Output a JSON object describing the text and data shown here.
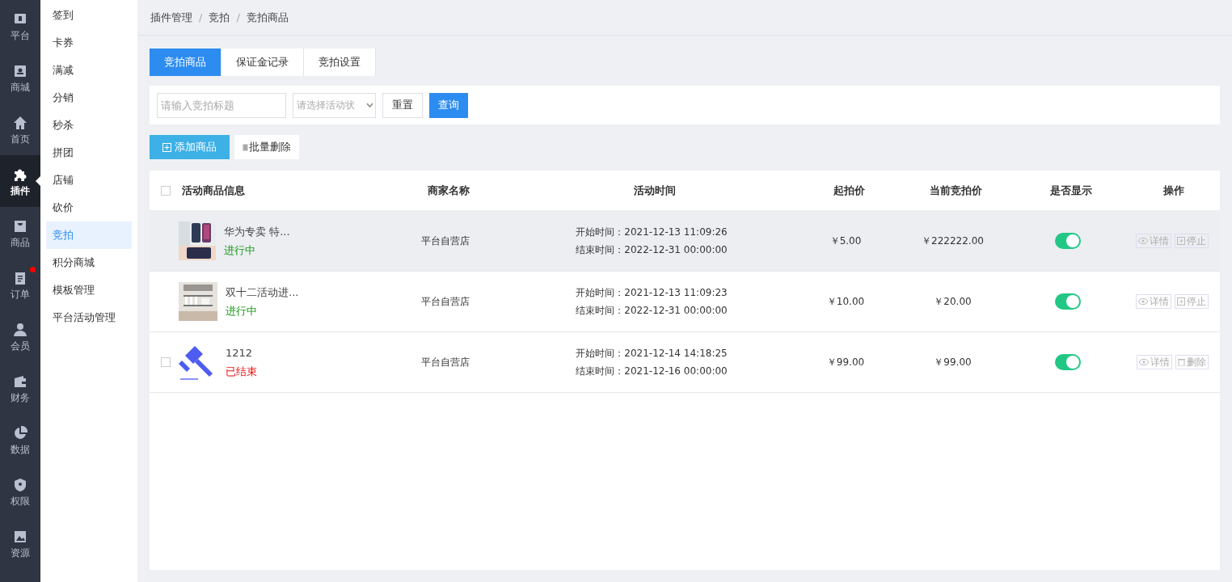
{
  "nav": [
    {
      "label": "平台",
      "selected": false,
      "badge": false
    },
    {
      "label": "商城",
      "selected": false,
      "badge": false
    },
    {
      "label": "首页",
      "selected": false,
      "badge": false
    },
    {
      "label": "插件",
      "selected": true,
      "badge": false
    },
    {
      "label": "商品",
      "selected": false,
      "badge": false
    },
    {
      "label": "订单",
      "selected": false,
      "badge": true
    },
    {
      "label": "会员",
      "selected": false,
      "badge": false
    },
    {
      "label": "财务",
      "selected": false,
      "badge": false
    },
    {
      "label": "数据",
      "selected": false,
      "badge": false
    },
    {
      "label": "权限",
      "selected": false,
      "badge": false
    },
    {
      "label": "资源",
      "selected": false,
      "badge": false
    }
  ],
  "submenu": [
    {
      "label": "签到",
      "selected": false
    },
    {
      "label": "卡券",
      "selected": false
    },
    {
      "label": "满减",
      "selected": false
    },
    {
      "label": "分销",
      "selected": false
    },
    {
      "label": "秒杀",
      "selected": false
    },
    {
      "label": "拼团",
      "selected": false
    },
    {
      "label": "店铺",
      "selected": false
    },
    {
      "label": "砍价",
      "selected": false
    },
    {
      "label": "竞拍",
      "selected": true
    },
    {
      "label": "积分商城",
      "selected": false
    },
    {
      "label": "模板管理",
      "selected": false
    },
    {
      "label": "平台活动管理",
      "selected": false
    }
  ],
  "breadcrumb": [
    {
      "label": "插件管理"
    },
    {
      "separator": "/",
      "label": "竞拍"
    },
    {
      "separator": "/",
      "label": "竞拍商品"
    }
  ],
  "tabs": [
    {
      "label": "竞拍商品",
      "selected": true
    },
    {
      "label": "保证金记录",
      "selected": false
    },
    {
      "label": "竞拍设置",
      "selected": false
    }
  ],
  "filters": {
    "title_placeholder": "请输入竞拍标题",
    "status_placeholder": "请选择活动状",
    "reset": "重置",
    "query": "查询"
  },
  "actions": {
    "add": "添加商品",
    "batch_delete": "批量删除"
  },
  "table": {
    "select_all_checked": false,
    "columns": [
      "活动商品信息",
      "商家名称",
      "活动时间",
      "起拍价",
      "当前竞拍价",
      "是否显示",
      "操作"
    ],
    "rows": [
      {
        "image": {
          "kind": "picture"
        },
        "title": "华为专卖 特...",
        "status": {
          "label": "进行中",
          "kind": "running"
        },
        "shop": "平台自营店",
        "start": "开始时间：2021-12-13 11:09:26",
        "end": "结束时间：2022-12-31 00:00:00",
        "start_price": "￥5.00",
        "current_price": "￥222222.00",
        "shown": true,
        "highlighted": true,
        "checkbox_visible": false,
        "ops": [
          {
            "kind": "view",
            "label": "详情"
          },
          {
            "kind": "stop",
            "label": "停止"
          }
        ]
      },
      {
        "image": {
          "kind": "picture"
        },
        "title": "双十二活动进...",
        "status": {
          "label": "进行中",
          "kind": "running"
        },
        "shop": "平台自营店",
        "start": "开始时间：2021-12-13 11:09:23",
        "end": "结束时间：2022-12-31 00:00:00",
        "start_price": "￥10.00",
        "current_price": "￥20.00",
        "shown": true,
        "highlighted": false,
        "checkbox_visible": false,
        "ops": [
          {
            "kind": "view",
            "label": "详情"
          },
          {
            "kind": "stop",
            "label": "停止"
          }
        ]
      },
      {
        "image": {
          "kind": "icon"
        },
        "title": "1212",
        "status": {
          "label": "已结束",
          "kind": "ended"
        },
        "shop": "平台自营店",
        "start": "开始时间：2021-12-14 14:18:25",
        "end": "结束时间：2021-12-16 00:00:00",
        "start_price": "￥99.00",
        "current_price": "￥99.00",
        "shown": true,
        "highlighted": false,
        "checkbox_visible": true,
        "checked": false,
        "ops": [
          {
            "kind": "view",
            "label": "详情"
          },
          {
            "kind": "delete",
            "label": "删除"
          }
        ]
      }
    ]
  }
}
